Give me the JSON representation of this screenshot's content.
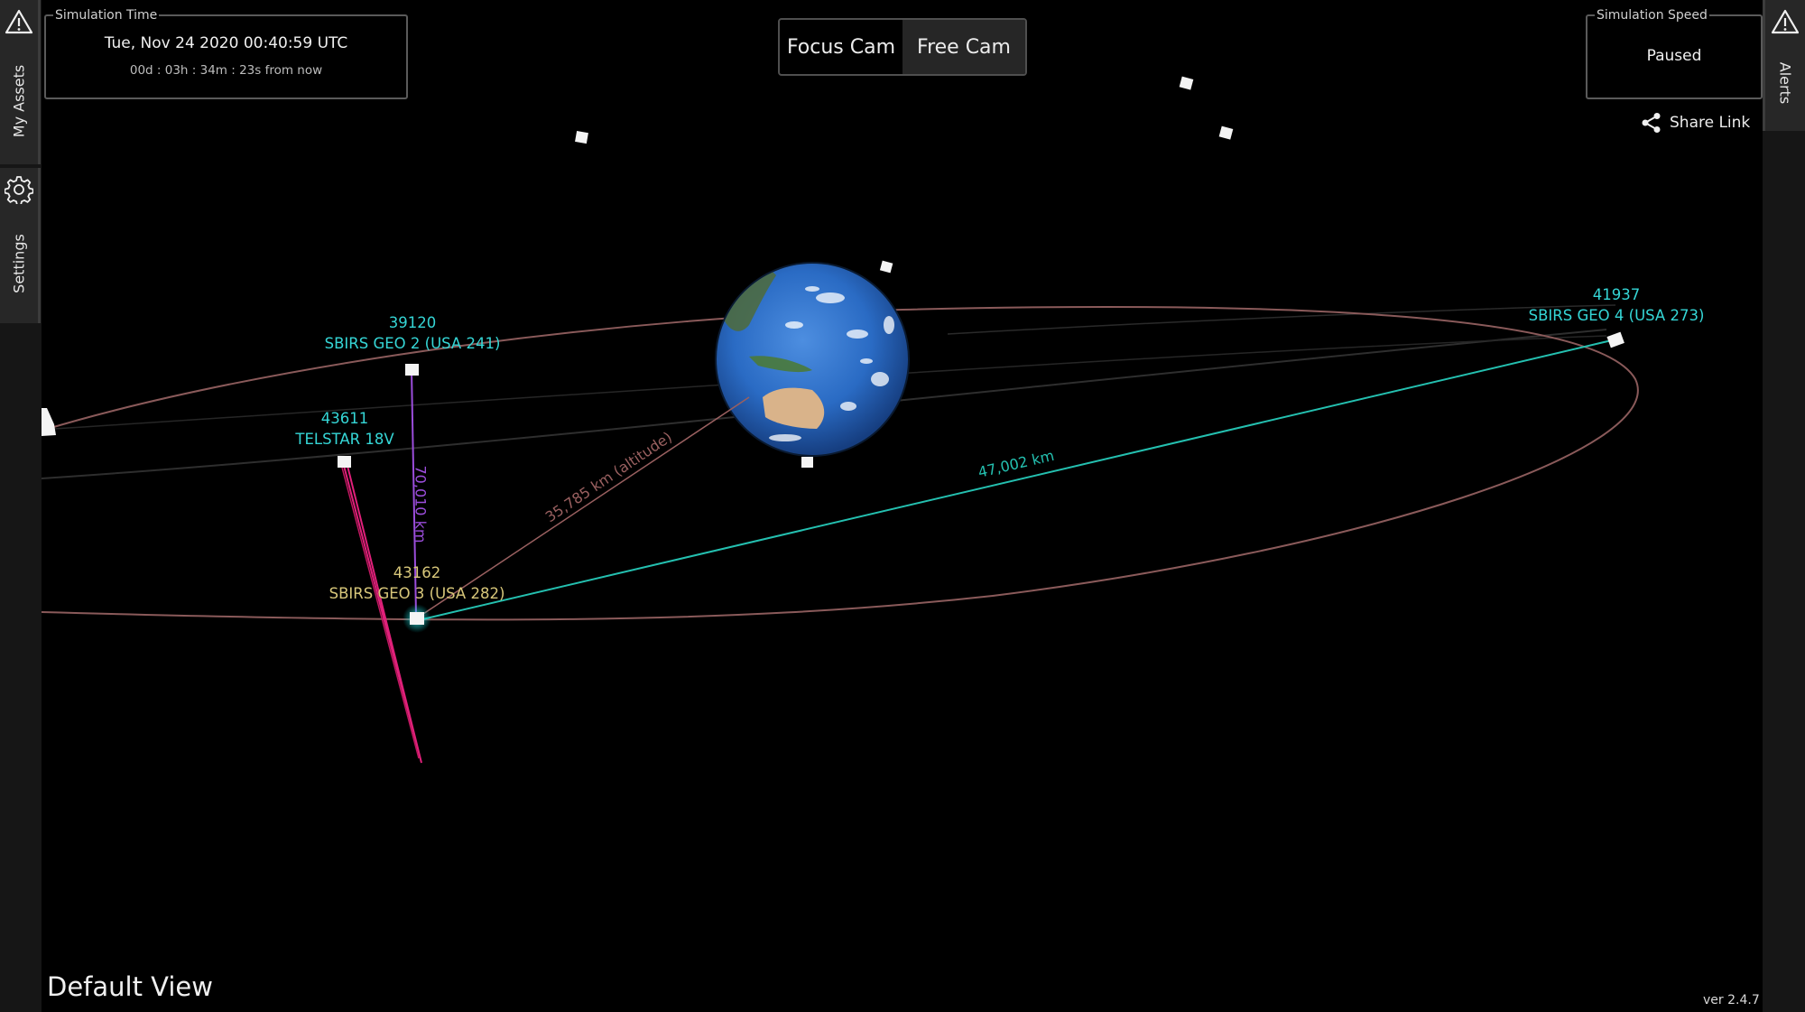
{
  "left_sidebar": {
    "alerts_icon": "warning-triangle-icon",
    "tabs": [
      {
        "label": "My Assets",
        "icon": null
      },
      {
        "label": "Settings",
        "icon": "gear-icon"
      }
    ]
  },
  "right_sidebar": {
    "alerts_icon": "warning-triangle-icon",
    "tabs": [
      {
        "label": "Alerts"
      }
    ]
  },
  "simulation_time": {
    "legend": "Simulation Time",
    "datetime": "Tue, Nov 24 2020 00:40:59 UTC",
    "relative": "00d : 03h : 34m : 23s from now"
  },
  "camera": {
    "options": [
      "Focus Cam",
      "Free Cam"
    ],
    "selected": "Free Cam"
  },
  "simulation_speed": {
    "legend": "Simulation Speed",
    "value": "Paused"
  },
  "share_link": {
    "label": "Share Link",
    "icon": "share-icon"
  },
  "view_name": "Default View",
  "version": "ver 2.4.7",
  "colors": {
    "label_cyan": "#35d6d6",
    "label_selected": "#d8c77a",
    "geo_orbit": "#8a5a5a",
    "telstar_orbit": "#e0207a",
    "range_line_purple": "#9b4ddb",
    "range_line_cyan": "#24c0b0",
    "altitude_line": "#9a6060"
  },
  "satellites": [
    {
      "norad_id": "39120",
      "name": "SBIRS GEO 2 (USA 241)",
      "label_color": "cyan"
    },
    {
      "norad_id": "43611",
      "name": "TELSTAR 18V",
      "label_color": "cyan"
    },
    {
      "norad_id": "43162",
      "name": "SBIRS GEO 3 (USA 282)",
      "label_color": "gold",
      "selected": true
    },
    {
      "norad_id": "41937",
      "name": "SBIRS GEO 4 (USA 273)",
      "label_color": "cyan"
    }
  ],
  "measurements": {
    "vertical_range": "70,010 km",
    "altitude": "35,785 km (altitude)",
    "range_to_geo4": "47,002 km"
  }
}
